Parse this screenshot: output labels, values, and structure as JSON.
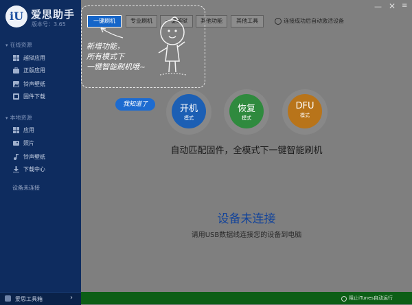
{
  "sidebar": {
    "logo_text": "iU",
    "brand": "爱思助手",
    "version": "版本号：3.65",
    "section_online": "在线资源",
    "online_items": [
      {
        "label": "越狱应用",
        "icon": "apps-icon"
      },
      {
        "label": "正版应用",
        "icon": "store-icon"
      },
      {
        "label": "铃声壁纸",
        "icon": "wallpaper-icon"
      },
      {
        "label": "固件下载",
        "icon": "firmware-icon"
      }
    ],
    "section_local": "本地资源",
    "local_items": [
      {
        "label": "应用",
        "icon": "app-icon"
      },
      {
        "label": "照片",
        "icon": "photo-icon"
      },
      {
        "label": "铃声壁纸",
        "icon": "ringtone-icon"
      },
      {
        "label": "下载中心",
        "icon": "download-icon"
      }
    ],
    "device_status": "设备未连接",
    "footer_label": "爱思工具箱",
    "footer_arrow": "›"
  },
  "tabs": [
    {
      "label": "一键刷机",
      "active": true
    },
    {
      "label": "专业刷机",
      "active": false
    },
    {
      "label": "一键越狱",
      "active": false
    },
    {
      "label": "其他功能",
      "active": false
    },
    {
      "label": "其他工具",
      "active": false
    }
  ],
  "auto_activate_label": "连接成功后自动激活设备",
  "tooltip_lines": [
    "新增功能，",
    "所有模式下",
    "一键智能刷机哦~"
  ],
  "got_it": "我知道了",
  "modes": [
    {
      "big": "开机",
      "small": "模式",
      "color": "#1c5fb4"
    },
    {
      "big": "恢复",
      "small": "模式",
      "color": "#2f8a3e"
    },
    {
      "big": "DFU",
      "small": "模式",
      "color": "#b8741a"
    }
  ],
  "tagline": "自动匹配固件，全模式下一键智能刷机",
  "not_connected_title": "设备未连接",
  "not_connected_desc": "请用USB数据线连接您的设备到电脑",
  "itunes_label": "阻止iTunes自动运行",
  "window": {
    "min": "—",
    "close": "✕",
    "menu": "≡"
  }
}
